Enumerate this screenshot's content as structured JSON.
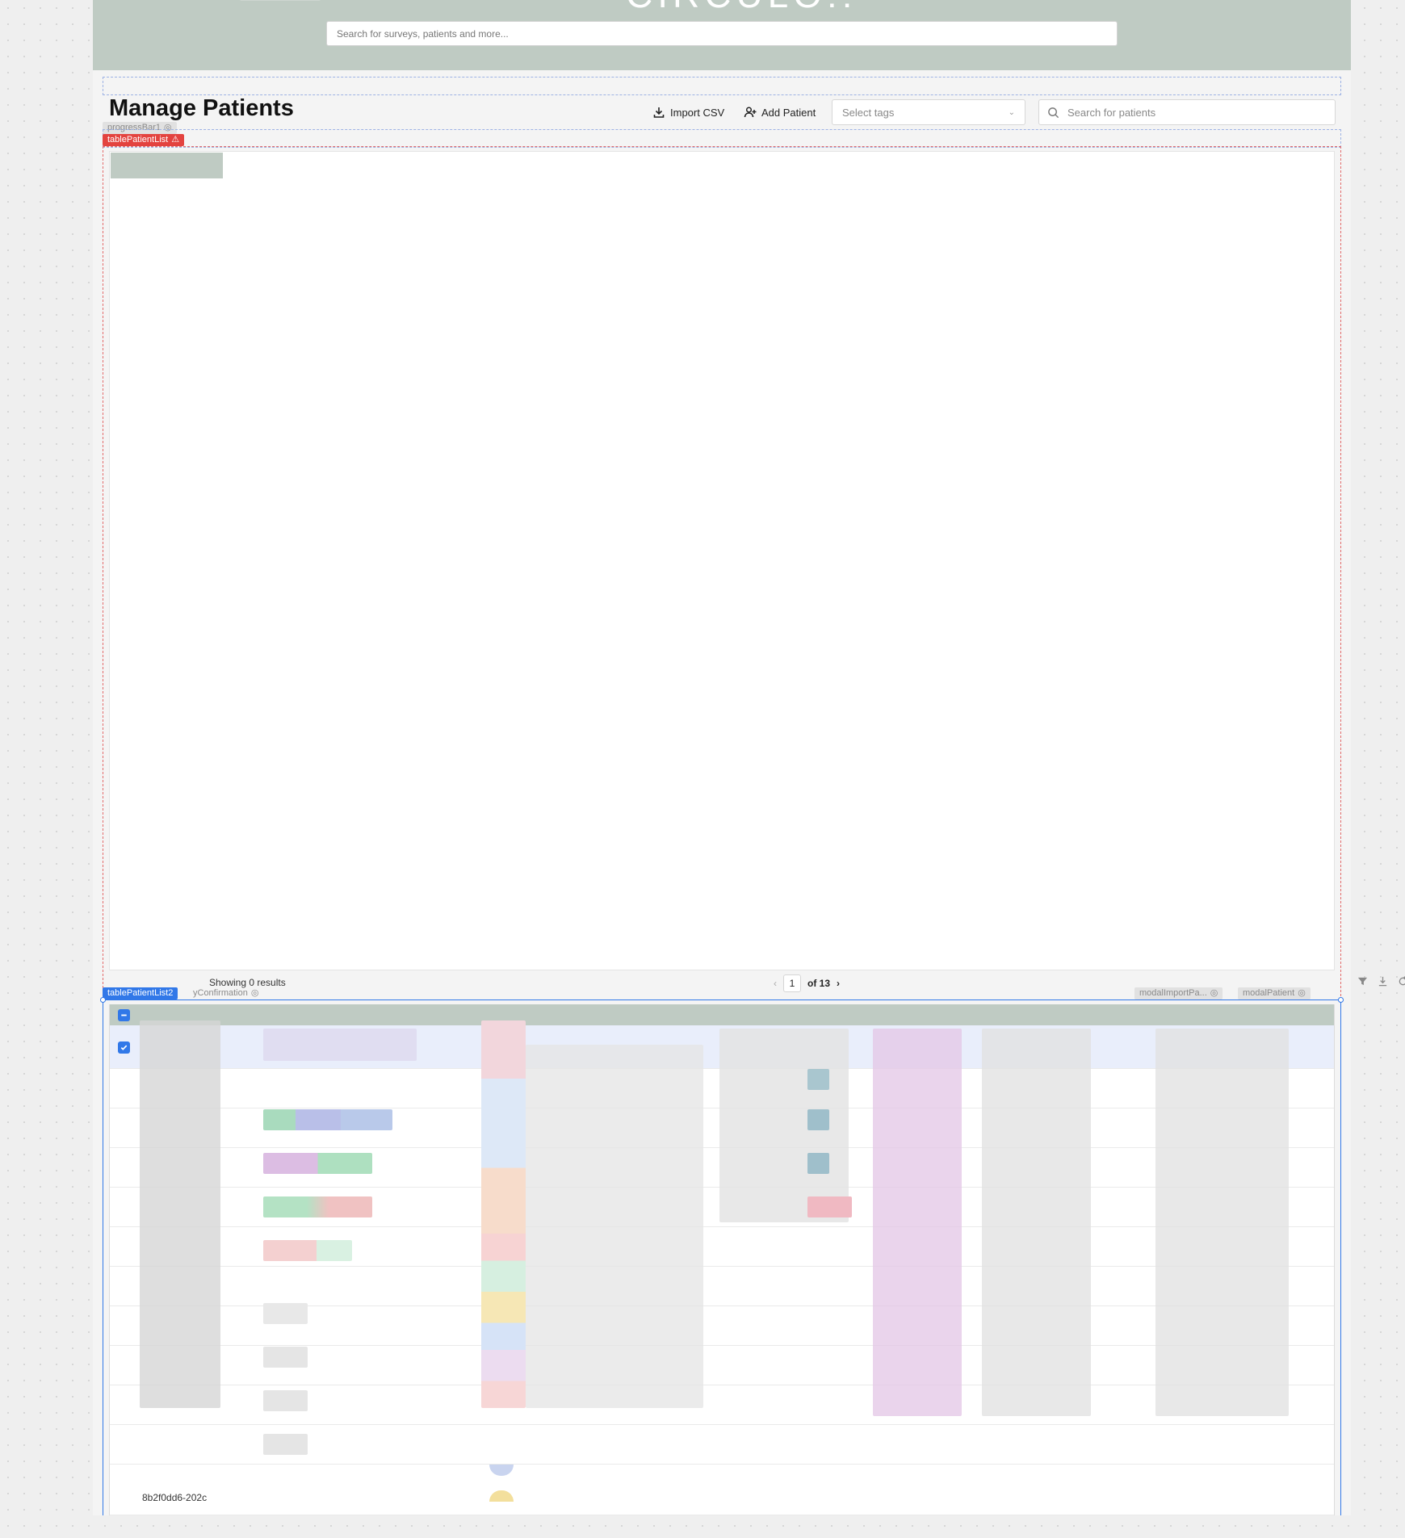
{
  "header": {
    "brand": "CIRCULO!!",
    "global_search_placeholder": "Search for surveys, patients and more..."
  },
  "page": {
    "title": "Manage Patients",
    "import_csv_label": "Import CSV",
    "add_patient_label": "Add Patient",
    "tags_placeholder": "Select tags",
    "patient_search_placeholder": "Search for patients"
  },
  "components": {
    "progress_bar": "progressBar1",
    "table_main": "tablePatientList",
    "table_secondary": "tablePatientList2",
    "modal_confirmation": "yConfirmation",
    "modal_import": "modalImportPa...",
    "modal_patient": "modalPatient"
  },
  "table_main": {
    "results_text": "Showing 0 results",
    "current_page": "1",
    "total_pages_label": "of 13"
  },
  "table_secondary": {
    "partial_row_text": "8b2f0dd6-202c"
  },
  "colors": {
    "header_bg": "#bfcbc3",
    "selected_row_bg": "#e9eefb",
    "accent_blue": "#3178e8",
    "error_red": "#e3433f"
  }
}
